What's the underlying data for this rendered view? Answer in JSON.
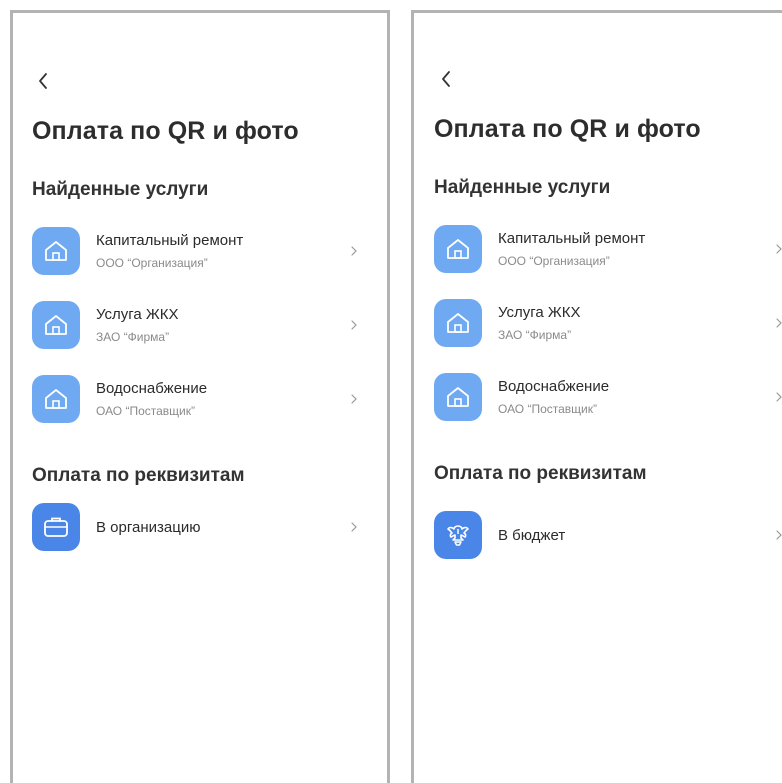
{
  "screens": [
    {
      "title": "Оплата по QR и фото",
      "found_section": "Найденные услуги",
      "services": [
        {
          "name": "Капитальный ремонт",
          "org": "ООО “Организация”",
          "icon": "house-icon"
        },
        {
          "name": "Услуга ЖКХ",
          "org": "ЗАО “Фирма”",
          "icon": "house-icon"
        },
        {
          "name": "Водоснабжение",
          "org": "ОАО “Поставщик”",
          "icon": "house-icon"
        }
      ],
      "requisites_section": "Оплата по реквизитам",
      "requisites_item": {
        "name": "В организацию",
        "icon": "briefcase-icon"
      }
    },
    {
      "title": "Оплата по QR и фото",
      "found_section": "Найденные услуги",
      "services": [
        {
          "name": "Капитальный ремонт",
          "org": "ООО “Организация”",
          "icon": "house-icon"
        },
        {
          "name": "Услуга ЖКХ",
          "org": "ЗАО “Фирма”",
          "icon": "house-icon"
        },
        {
          "name": "Водоснабжение",
          "org": "ОАО “Поставщик”",
          "icon": "house-icon"
        }
      ],
      "requisites_section": "Оплата по реквизитам",
      "requisites_item": {
        "name": "В бюджет",
        "icon": "emblem-icon"
      }
    }
  ],
  "colors": {
    "icon_light": "#6ea9f2",
    "icon_dark": "#4a86e8",
    "frame": "#b3b3b3"
  }
}
